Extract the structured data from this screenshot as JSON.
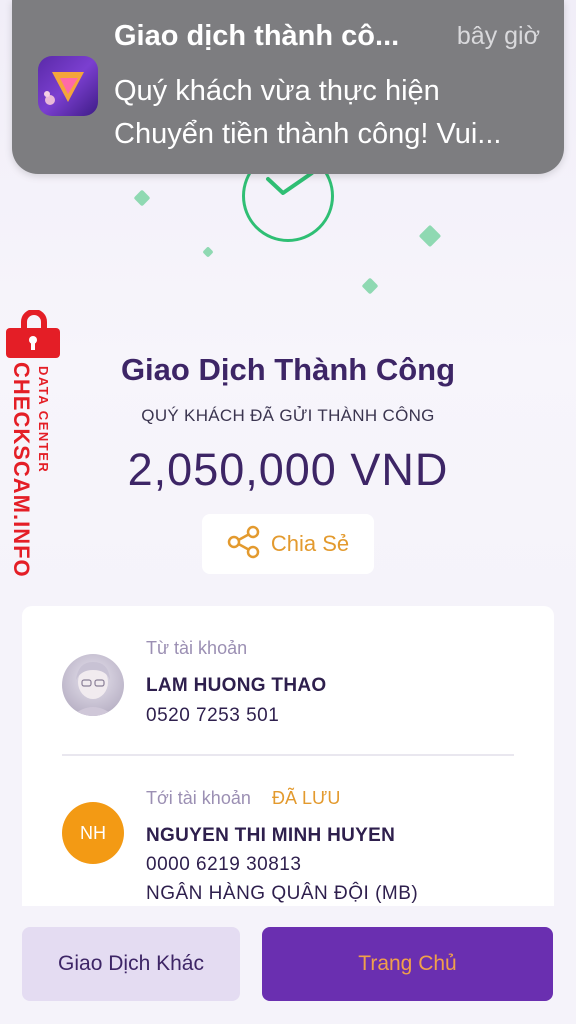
{
  "notification": {
    "title": "Giao dịch thành cô...",
    "time": "bây giờ",
    "body_line1": "Quý khách vừa thực hiện",
    "body_line2": "Chuyển tiền thành công! Vui..."
  },
  "watermark": {
    "main": "CHECKSCAM.INFO",
    "sub": "DATA CENTER"
  },
  "result": {
    "title": "Giao Dịch Thành Công",
    "subtitle": "QUÝ KHÁCH ĐÃ GỬI THÀNH CÔNG",
    "amount": "2,050,000 VND",
    "share_label": "Chia Sẻ"
  },
  "from": {
    "label": "Từ tài khoản",
    "name": "LAM HUONG THAO",
    "account": "0520 7253 501"
  },
  "to": {
    "label": "Tới tài khoản",
    "saved_badge": "ĐÃ LƯU",
    "avatar_initials": "NH",
    "name": "NGUYEN THI MINH HUYEN",
    "account": "0000 6219 30813",
    "bank": "NGÂN HÀNG QUÂN ĐỘI (MB)"
  },
  "actions": {
    "other_label": "Giao Dịch Khác",
    "home_label": "Trang Chủ"
  },
  "colors": {
    "primary": "#6a2fb0",
    "accent": "#e39a2e",
    "success": "#2fbf74",
    "watermark": "#e41e26"
  },
  "icons": [
    "app-icon",
    "check-icon",
    "share-icon",
    "lock-icon"
  ]
}
